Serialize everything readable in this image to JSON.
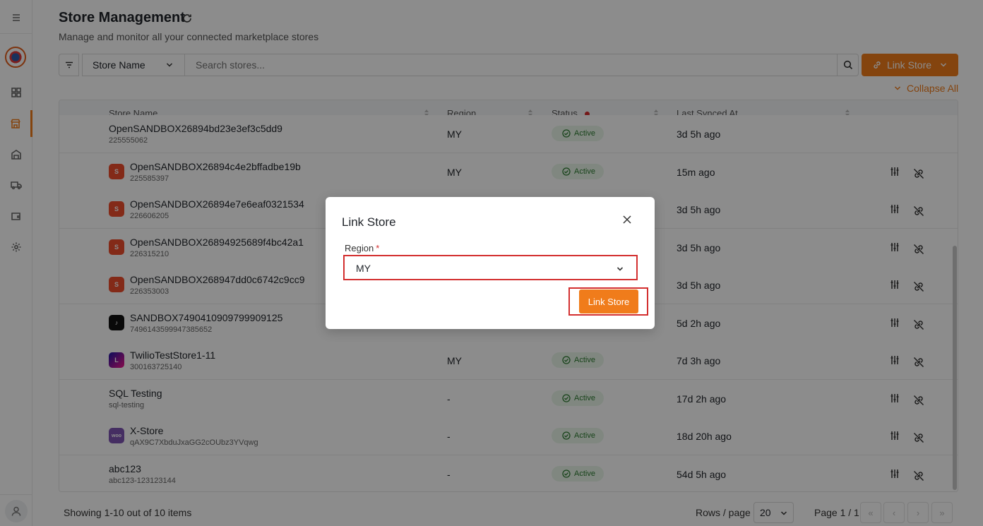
{
  "page": {
    "title": "Store Management",
    "subtitle": "Manage and monitor all your connected marketplace stores"
  },
  "toolbar": {
    "filter_field": "Store Name",
    "search_placeholder": "Search stores...",
    "link_store_label": "Link Store",
    "collapse_all_label": "Collapse All"
  },
  "table": {
    "columns": {
      "store_name": "Store Name",
      "region": "Region",
      "status": "Status",
      "last_synced": "Last Synced At"
    },
    "rows": [
      {
        "name": "OpenSANDBOX26894bd23e3ef3c5dd9",
        "id": "225555062",
        "platform": "shopee",
        "region": "MY",
        "status": "Active",
        "synced": "3d 5h ago"
      },
      {
        "name": "OpenSANDBOX26894c4e2bffadbe19b",
        "id": "225585397",
        "platform": "shopee",
        "region": "MY",
        "status": "Active",
        "synced": "15m ago"
      },
      {
        "name": "OpenSANDBOX26894e7e6eaf0321534",
        "id": "226606205",
        "platform": "shopee",
        "region": "",
        "status": "",
        "synced": "3d 5h ago"
      },
      {
        "name": "OpenSANDBOX26894925689f4bc42a1",
        "id": "226315210",
        "platform": "shopee",
        "region": "",
        "status": "",
        "synced": "3d 5h ago"
      },
      {
        "name": "OpenSANDBOX268947dd0c6742c9cc9",
        "id": "226353003",
        "platform": "shopee",
        "region": "",
        "status": "",
        "synced": "3d 5h ago"
      },
      {
        "name": "SANDBOX7490410909799909125",
        "id": "7496143599947385652",
        "platform": "tiktok",
        "region": "",
        "status": "",
        "synced": "5d 2h ago"
      },
      {
        "name": "TwilioTestStore1-11",
        "id": "300163725140",
        "platform": "lazada",
        "region": "MY",
        "status": "Active",
        "synced": "7d 3h ago"
      },
      {
        "name": "SQL Testing",
        "id": "sql-testing",
        "platform": "",
        "region": "-",
        "status": "Active",
        "synced": "17d 2h ago"
      },
      {
        "name": "X-Store",
        "id": "qAX9C7XbduJxaGG2cOUbz3YVqwg",
        "platform": "woo",
        "region": "-",
        "status": "Active",
        "synced": "18d 20h ago"
      },
      {
        "name": "abc123",
        "id": "abc123-123123144",
        "platform": "",
        "region": "-",
        "status": "Active",
        "synced": "54d 5h ago"
      }
    ]
  },
  "footer": {
    "showing": "Showing 1-10 out of 10 items",
    "rows_per_page_label": "Rows / page",
    "rows_per_page_value": "20",
    "page_label": "Page 1 / 1"
  },
  "modal": {
    "title": "Link Store",
    "region_label": "Region",
    "required_mark": "*",
    "region_value": "MY",
    "submit_label": "Link Store"
  },
  "icons": {
    "woo_text": "woo"
  },
  "colors": {
    "accent": "#f07c1b",
    "active_bg": "#e9f6ea",
    "active_text": "#2e7d32",
    "highlight": "#d32f2f"
  }
}
